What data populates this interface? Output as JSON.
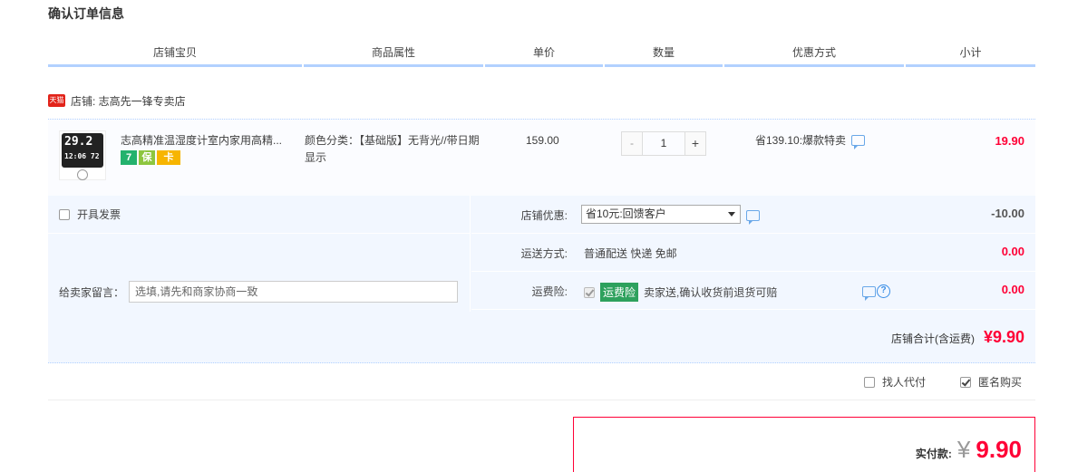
{
  "page": {
    "title": "确认订单信息"
  },
  "columns": [
    "店铺宝贝",
    "商品属性",
    "单价",
    "数量",
    "优惠方式",
    "小计"
  ],
  "shop": {
    "badge": "天猫",
    "name": "店铺: 志高先一锋专卖店"
  },
  "item": {
    "title": "志高精准温湿度计室内家用高精...",
    "thumb_top": "29.2",
    "thumb_bottom": "12:06 72",
    "badges": [
      "7",
      "保",
      "卡"
    ],
    "attr": "颜色分类：【基础版】无背光//带日期显示",
    "price": "159.00",
    "qty_minus": "-",
    "qty": "1",
    "qty_plus": "+",
    "discount": "省139.10:爆款特卖",
    "subtotal": "19.90"
  },
  "invoice": {
    "label": "开具发票"
  },
  "message": {
    "label": "给卖家留言：",
    "placeholder": "选填,请先和商家协商一致"
  },
  "shop_discount": {
    "label": "店铺优惠:",
    "selected": "省10元:回馈客户",
    "amount": "-10.00"
  },
  "shipping": {
    "label": "运送方式:",
    "value": "普通配送 快递 免邮",
    "amount": "0.00"
  },
  "insurance": {
    "label": "运费险:",
    "tag": "运费险",
    "text": "卖家送,确认收货前退货可赔",
    "help": "?",
    "amount": "0.00"
  },
  "shop_total": {
    "label": "店铺合计(含运费)",
    "value": "¥9.90"
  },
  "options": {
    "proxy_pay": "找人代付",
    "anonymous": "匿名购买"
  },
  "payment": {
    "label": "实付款:",
    "currency": "¥",
    "value": "9.90"
  }
}
